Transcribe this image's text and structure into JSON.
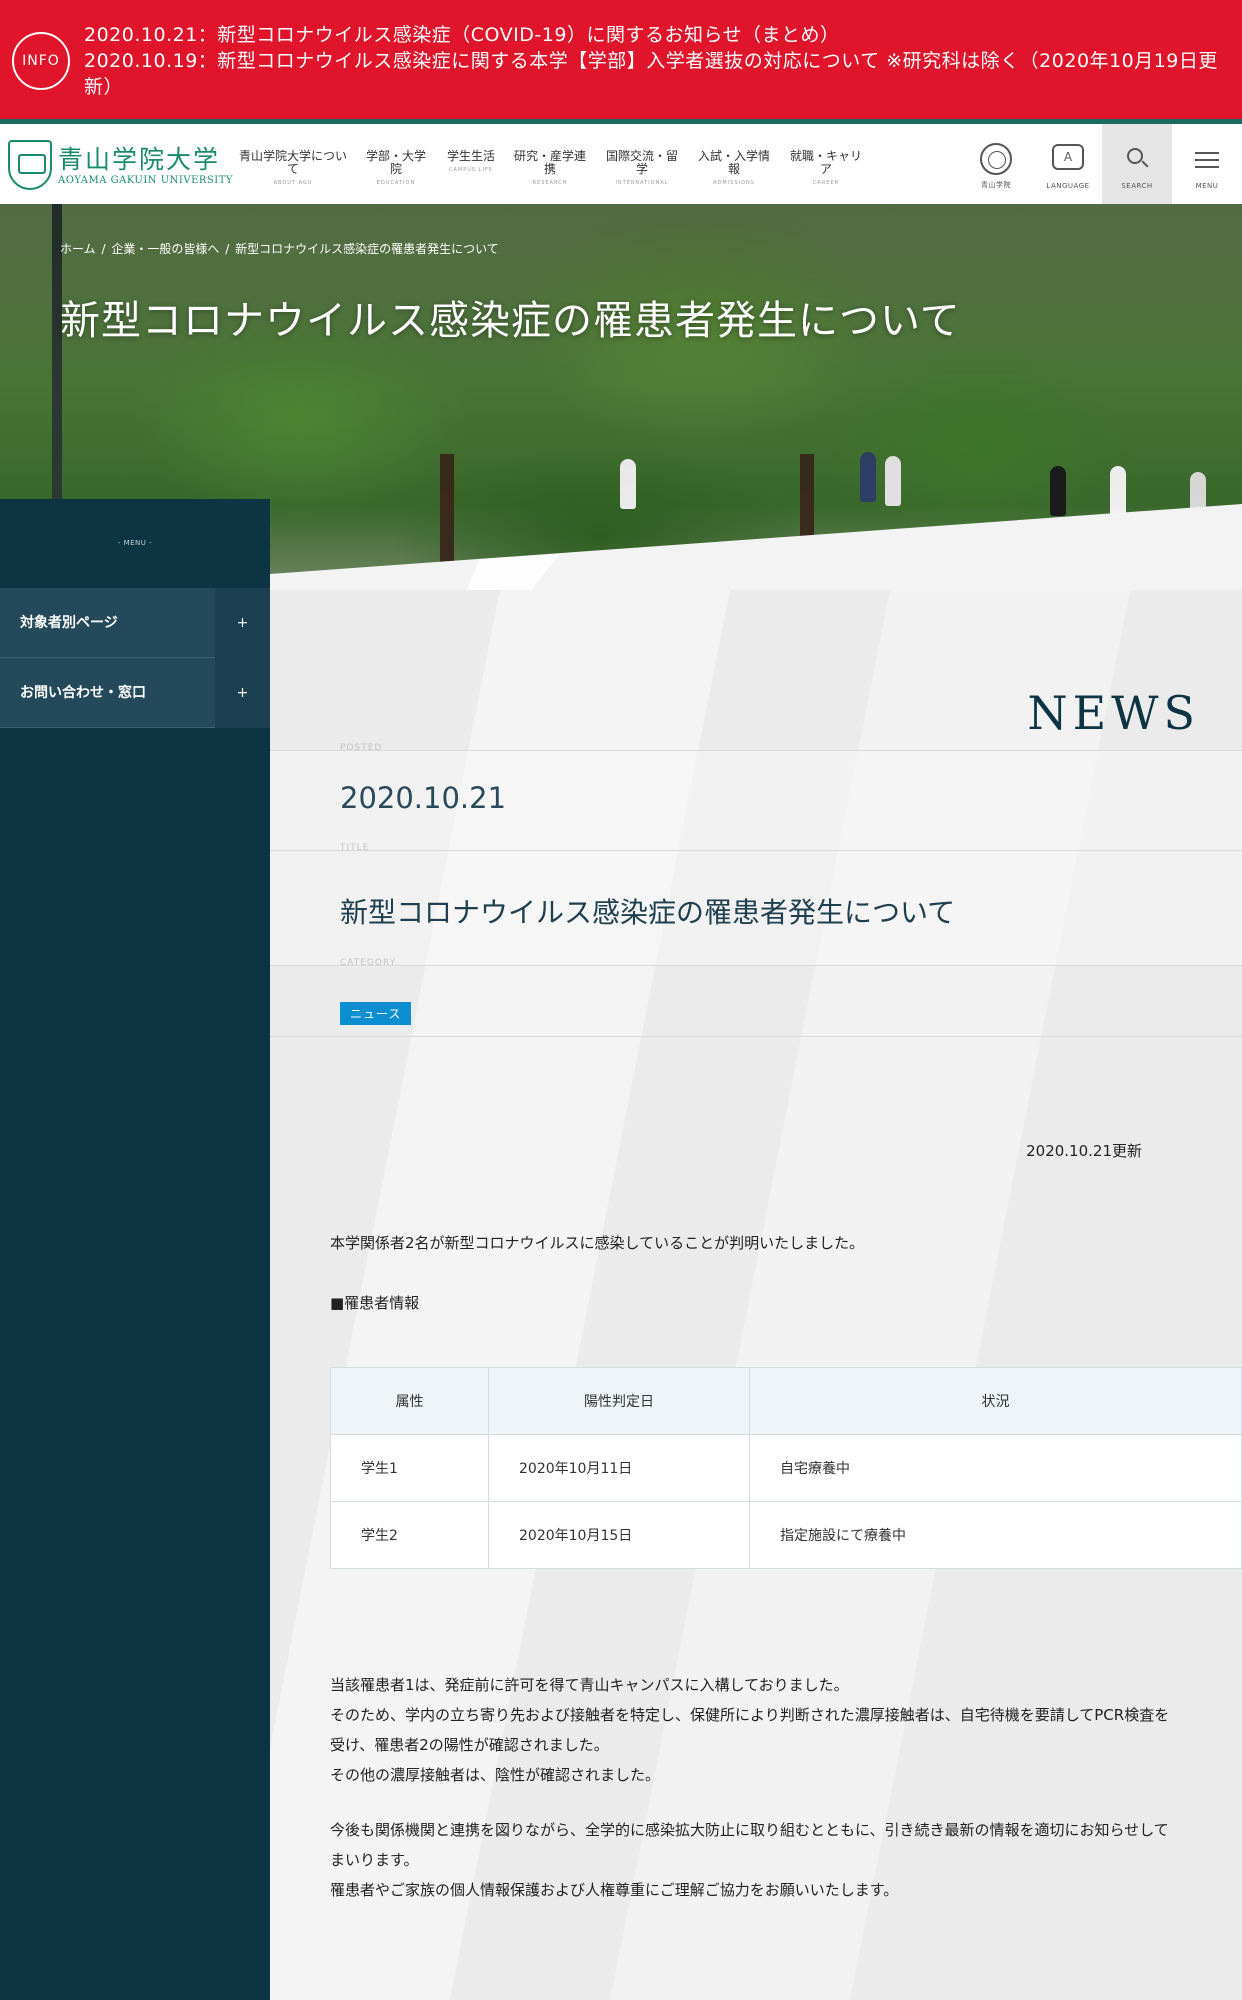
{
  "info": {
    "badge": "INFO",
    "lines": [
      "2020.10.21：新型コロナウイルス感染症（COVID-19）に関するお知らせ（まとめ）",
      "2020.10.19：新型コロナウイルス感染症に関する本学【学部】入学者選抜の対応について ※研究科は除く（2020年10月19日更新）"
    ]
  },
  "header": {
    "logo_jp": "青山学院大学",
    "logo_en": "AOYAMA GAKUIN UNIVERSITY",
    "nav": [
      {
        "jp": "青山学院大学について",
        "en": "ABOUT AGU"
      },
      {
        "jp": "学部・大学院",
        "en": "EDUCATION"
      },
      {
        "jp": "学生生活",
        "en": "CAMPUS LIFE"
      },
      {
        "jp": "研究・産学連携",
        "en": "RESEARCH"
      },
      {
        "jp": "国際交流・留学",
        "en": "INTERNATIONAL"
      },
      {
        "jp": "入試・入学情報",
        "en": "ADMISSIONS"
      },
      {
        "jp": "就職・キャリア",
        "en": "CAREER"
      }
    ],
    "utils": {
      "emblem": "青山学院",
      "lang_letter": "A",
      "language": "LANGUAGE",
      "search": "SEARCH",
      "menu": "MENU"
    }
  },
  "hero": {
    "breadcrumb": [
      "ホーム",
      "/",
      "企業・一般の皆様へ",
      "/",
      "新型コロナウイルス感染症の罹患者発生について"
    ],
    "title": "新型コロナウイルス感染症の罹患者発生について"
  },
  "sidebar": {
    "menu_label": "- MENU -",
    "items": [
      {
        "label": "対象者別ページ",
        "toggle": "+"
      },
      {
        "label": "お問い合わせ・窓口",
        "toggle": "+"
      }
    ]
  },
  "article": {
    "section_heading": "NEWS",
    "posted_label": "POSTED",
    "posted_date": "2020.10.21",
    "title_label": "TITLE",
    "title": "新型コロナウイルス感染症の罹患者発生について",
    "category_label": "CATEGORY",
    "category": "ニュース",
    "updated": "2020.10.21更新",
    "intro": "本学関係者2名が新型コロナウイルスに感染していることが判明いたしました。",
    "patients_heading": "■罹患者情報",
    "table": {
      "headers": [
        "属性",
        "陽性判定日",
        "状況"
      ],
      "rows": [
        [
          "学生1",
          "2020年10月11日",
          "自宅療養中"
        ],
        [
          "学生2",
          "2020年10月15日",
          "指定施設にて療養中"
        ]
      ]
    },
    "body1": [
      "当該罹患者1は、発症前に許可を得て青山キャンパスに入構しておりました。",
      "そのため、学内の立ち寄り先および接触者を特定し、保健所により判断された濃厚接触者は、自宅待機を要請してPCR検査を受け、罹患者2の陽性が確認されました。",
      "その他の濃厚接触者は、陰性が確認されました。"
    ],
    "body2": [
      "今後も関係機関と連携を図りながら、全学的に感染拡大防止に取り組むとともに、引き続き最新の情報を適切にお知らせしてまいります。",
      "罹患者やご家族の個人情報保護および人権尊重にご理解ご協力をお願いいたします。"
    ]
  },
  "colors": {
    "info_red": "#e0142a",
    "brand_green": "#1a8a6e",
    "sidebar_navy": "#0c3443",
    "category_blue": "#0b8fd0"
  }
}
